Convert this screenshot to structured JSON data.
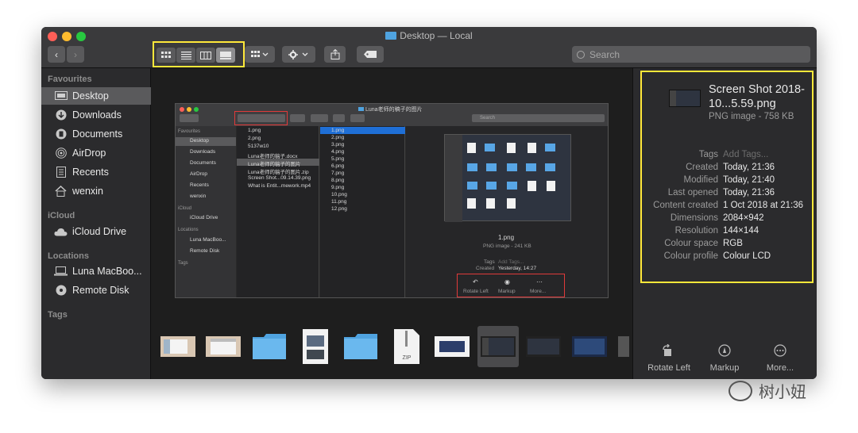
{
  "window": {
    "title": "Desktop — Local"
  },
  "toolbar": {
    "back_label": "‹",
    "forward_label": "›",
    "search_placeholder": "Search"
  },
  "sidebar": {
    "favourites_header": "Favourites",
    "favourites": [
      {
        "label": "Desktop",
        "icon": "desktop-icon",
        "selected": true
      },
      {
        "label": "Downloads",
        "icon": "download-icon"
      },
      {
        "label": "Documents",
        "icon": "document-icon"
      },
      {
        "label": "AirDrop",
        "icon": "airdrop-icon"
      },
      {
        "label": "Recents",
        "icon": "recents-icon"
      },
      {
        "label": "wenxin",
        "icon": "home-icon"
      }
    ],
    "icloud_header": "iCloud",
    "icloud": [
      {
        "label": "iCloud Drive",
        "icon": "cloud-icon"
      }
    ],
    "locations_header": "Locations",
    "locations": [
      {
        "label": "Luna MacBoo...",
        "icon": "laptop-icon"
      },
      {
        "label": "Remote Disk",
        "icon": "disk-icon"
      }
    ],
    "tags_header": "Tags"
  },
  "preview_inner": {
    "title": "Luna老师的稿子的图片",
    "search": "Search",
    "sidebar": {
      "favourites_header": "Favourites",
      "items": [
        "Desktop",
        "Downloads",
        "Documents",
        "AirDrop",
        "Recents",
        "wenxin"
      ],
      "icloud_header": "iCloud",
      "icloud_items": [
        "iCloud Drive"
      ],
      "locations_header": "Locations",
      "locations_items": [
        "Luna MacBoo...",
        "Remote Disk"
      ],
      "tags_header": "Tags"
    },
    "col1": [
      "1.png",
      "2.png",
      "5137w10",
      "Luna老师的稿子.docx",
      "Luna老师的稿子的图片",
      "Luna老师的稿子的图片.zip",
      "Screen Shot...09.14.39.png",
      "What is Entit...mework.mp4"
    ],
    "col2": [
      "1.png",
      "2.png",
      "3.png",
      "4.png",
      "5.png",
      "6.png",
      "7.png",
      "8.png",
      "9.png",
      "10.png",
      "11.png",
      "12.png"
    ],
    "preview_name": "1.png",
    "preview_kind": "PNG image - 241 KB",
    "tags_label": "Tags",
    "tags_value": "Add Tags...",
    "created_label": "Created",
    "created_value": "Yesterday, 14:27",
    "actions": [
      "Rotate Left",
      "Markup",
      "More..."
    ]
  },
  "info": {
    "file_name": "Screen Shot 2018-10...5.59.png",
    "file_kind": "PNG image - 758 KB",
    "rows": [
      {
        "label": "Tags",
        "value": "Add Tags...",
        "muted": true
      },
      {
        "label": "Created",
        "value": "Today, 21:36"
      },
      {
        "label": "Modified",
        "value": "Today, 21:40"
      },
      {
        "label": "Last opened",
        "value": "Today, 21:36"
      },
      {
        "label": "Content created",
        "value": "1 Oct 2018 at 21:36"
      },
      {
        "label": "Dimensions",
        "value": "2084×942"
      },
      {
        "label": "Resolution",
        "value": "144×144"
      },
      {
        "label": "Colour space",
        "value": "RGB"
      },
      {
        "label": "Colour profile",
        "value": "Colour LCD"
      }
    ],
    "actions": [
      {
        "label": "Rotate Left",
        "icon": "rotate-left-icon"
      },
      {
        "label": "Markup",
        "icon": "markup-icon"
      },
      {
        "label": "More...",
        "icon": "more-icon"
      }
    ]
  },
  "thumbnail_zip_label": "ZIP",
  "watermark": "树小妞",
  "colors": {
    "highlight_yellow": "#ffe83a",
    "highlight_red": "#e03a3a",
    "folder_blue": "#4fa3e0",
    "window_bg": "#1e1e1e"
  }
}
